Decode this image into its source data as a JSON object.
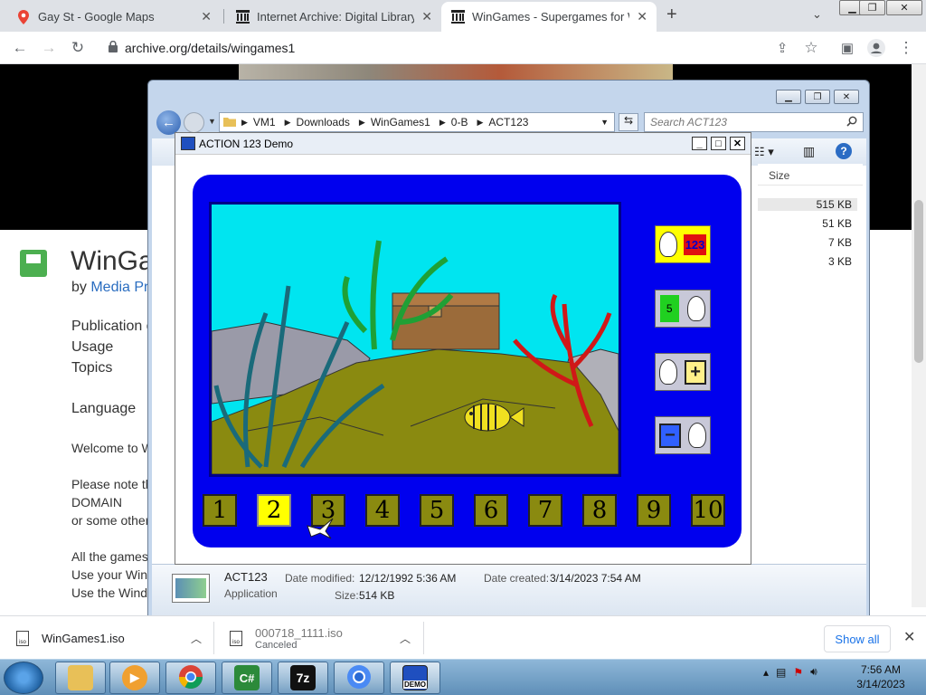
{
  "browser": {
    "tabs": [
      {
        "title": "Gay St - Google Maps",
        "icon": "google-maps-pin-icon"
      },
      {
        "title": "Internet Archive: Digital Library o",
        "icon": "archive-building-icon"
      },
      {
        "title": "WinGames - Supergames for Wi",
        "icon": "archive-building-icon"
      }
    ],
    "url": "archive.org/details/wingames1"
  },
  "page": {
    "title": "WinGa",
    "by_prefix": "by ",
    "by_link": "Media Pr",
    "meta": [
      "Publication d",
      "Usage",
      "Topics",
      "Language"
    ],
    "text_lines": [
      "Welcome to W",
      "Please note th",
      "DOMAIN",
      "or some other",
      "All the games",
      "Use your Win",
      "Use the Wind"
    ]
  },
  "explorer": {
    "path": [
      "VM1",
      "Downloads",
      "WinGames1",
      "0-B",
      "ACT123"
    ],
    "search_placeholder": "Search ACT123",
    "column_header": "Size",
    "sizes": [
      "515 KB",
      "51 KB",
      "7 KB",
      "3 KB"
    ],
    "details": {
      "name": "ACT123",
      "type": "Application",
      "modified_label": "Date modified:",
      "modified_value": "12/12/1992 5:36 AM",
      "created_label": "Date created:",
      "created_value": "3/14/2023 7:54 AM",
      "size_label": "Size:",
      "size_value": "514 KB"
    }
  },
  "game": {
    "window_title": "ACTION 123 Demo",
    "number_buttons": [
      "1",
      "2",
      "3",
      "4",
      "5",
      "6",
      "7",
      "8",
      "9",
      "10"
    ],
    "selected_number": "2",
    "button_labels": {
      "counting": "123",
      "dots": "5",
      "plus": "+",
      "minus": "−"
    }
  },
  "downloads": {
    "items": [
      {
        "name": "WinGames1.iso",
        "status": ""
      },
      {
        "name": "000718_1111.iso",
        "status": "Canceled"
      }
    ],
    "show_all": "Show all"
  },
  "taskbar": {
    "apps": [
      "explorer-folder-icon",
      "media-player-icon",
      "chrome-icon",
      "csharp-icon",
      "7zip-icon",
      "chromium-icon",
      "action123-demo-icon"
    ],
    "app_labels": {
      "csharp": "C#",
      "sevenzip": "7z",
      "demo": "DEMO"
    },
    "time": "7:56 AM",
    "date": "3/14/2023"
  },
  "colors": {
    "game_board": "#0000ee",
    "water": "#00e5f0",
    "sand": "#8a8a10",
    "selected_button": "#ffff00"
  }
}
